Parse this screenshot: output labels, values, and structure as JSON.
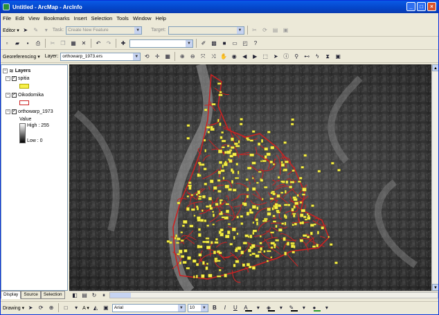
{
  "window": {
    "title": "Untitled - ArcMap - ArcInfo",
    "controls": [
      "_",
      "□",
      "×"
    ]
  },
  "menu": [
    "File",
    "Edit",
    "View",
    "Bookmarks",
    "Insert",
    "Selection",
    "Tools",
    "Window",
    "Help"
  ],
  "editor_toolbar": {
    "editor_label": "Editor ▾",
    "task_label": "Task:",
    "task_value": "Create New Feature",
    "target_label": "Target:",
    "target_value": ""
  },
  "georef_toolbar": {
    "label": "Georeferencing ▾",
    "layer_label": "Layer:",
    "layer_value": "orthowarp_1973.ers"
  },
  "toc": {
    "root": "Layers",
    "layers": [
      {
        "name": "spitia",
        "checked": true,
        "expanded": true,
        "swatch": "#f7f04a"
      },
      {
        "name": "Oikodomika",
        "checked": true,
        "expanded": true,
        "swatch": "#cc2222"
      },
      {
        "name": "orthowarp_1973",
        "checked": true,
        "expanded": true,
        "legend_title": "Value",
        "high": "High : 255",
        "low": "Low : 0"
      }
    ],
    "tabs": [
      "Display",
      "Source",
      "Selection"
    ]
  },
  "draw_toolbar": {
    "drawing_label": "Drawing ▾",
    "font": "Arial",
    "size": "10",
    "bold": "B",
    "italic": "I",
    "underline": "U",
    "text_tool": "A ▾"
  },
  "colors": {
    "accent": "#0a5ae6",
    "polygon_fill": "#f7f04a",
    "boundary": "#cc2222"
  }
}
